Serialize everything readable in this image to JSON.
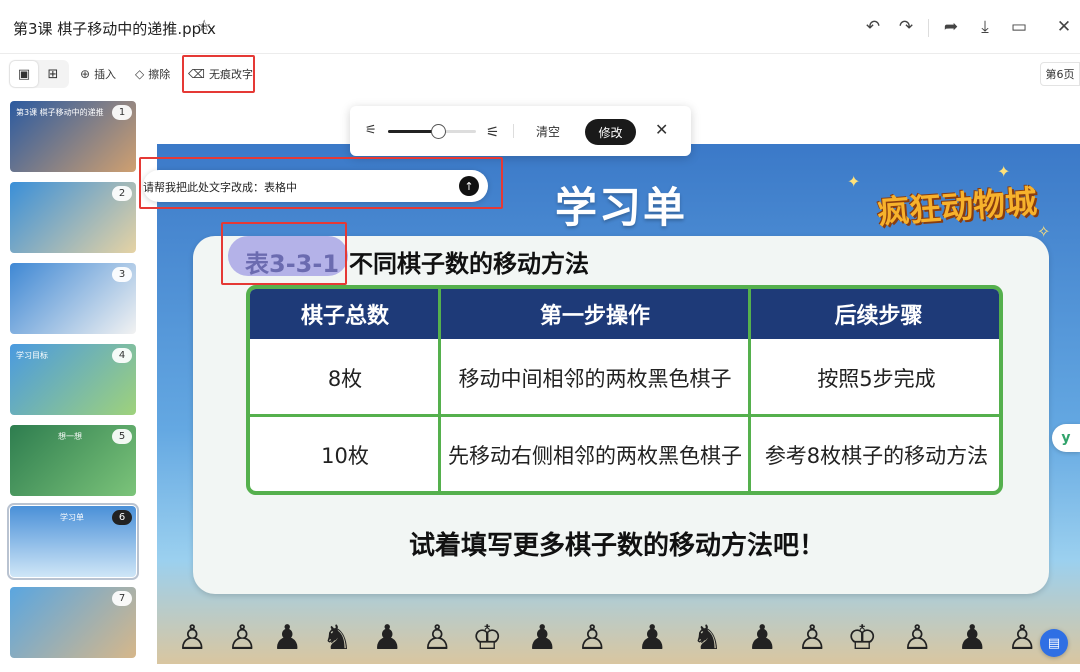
{
  "window": {
    "title": "第3课 棋子移动中的递推.pptx",
    "icons": [
      "star-icon",
      "undo-icon",
      "redo-icon",
      "share-icon",
      "download-icon",
      "present-icon",
      "close-icon"
    ]
  },
  "toolbar": {
    "insert_label": "插入",
    "erase_label": "擦除",
    "remove_text_label": "无痕改字",
    "page_indicator": "第6页"
  },
  "thumbnails": [
    {
      "num": "1",
      "caption": "第3课 棋子移动中的递推"
    },
    {
      "num": "2",
      "caption": ""
    },
    {
      "num": "3",
      "caption": ""
    },
    {
      "num": "4",
      "caption": "学习目标"
    },
    {
      "num": "5",
      "caption": "想一想"
    },
    {
      "num": "6",
      "caption": "学习单"
    },
    {
      "num": "7",
      "caption": ""
    }
  ],
  "editbar": {
    "clear_label": "清空",
    "modify_label": "修改",
    "brush_level": 0.57
  },
  "prompt": {
    "text": "请帮我把此处文字改成：表格中"
  },
  "slide": {
    "title": "学习单",
    "logo": "疯狂动物城",
    "table_label": "表3-3-1",
    "table_caption": "不同棋子数的移动方法",
    "headers": [
      "棋子总数",
      "第一步操作",
      "后续步骤"
    ],
    "rows": [
      [
        "8枚",
        "移动中间相邻的两枚黑色棋子",
        "按照5步完成"
      ],
      [
        "10枚",
        "先移动右侧相邻的两枚黑色棋子",
        "参考8枚棋子的移动方法"
      ]
    ],
    "bottom_text": "试着填写更多棋子数的移动方法吧！"
  },
  "colors": {
    "accent_red": "#e53935",
    "table_header": "#1e3a78",
    "table_border": "#55b04d"
  }
}
